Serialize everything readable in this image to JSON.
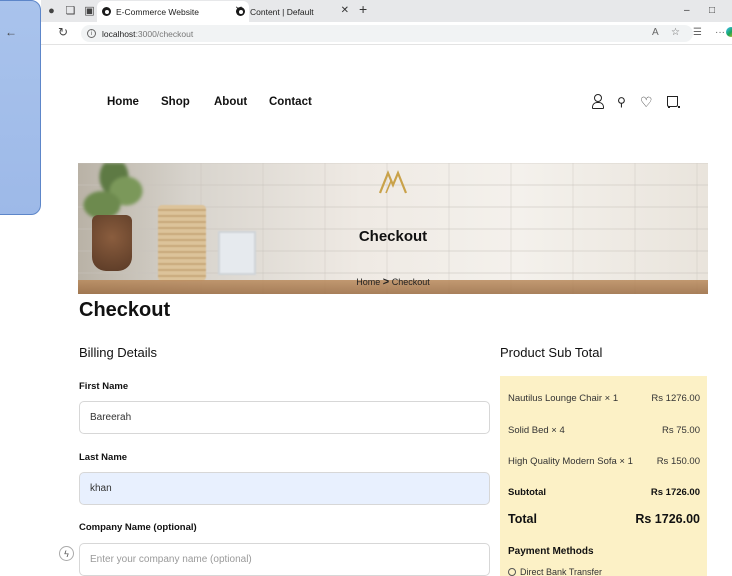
{
  "browser": {
    "tabs": [
      {
        "label": "E-Commerce Website",
        "active": true
      },
      {
        "label": "Content | Default",
        "active": false
      }
    ],
    "new_tab_symbol": "+",
    "url_host": "localhost",
    "url_path": ":3000/checkout",
    "window_min": "–",
    "window_restore": "ꝺ",
    "more_symbol": "···"
  },
  "nav": {
    "links": [
      "Home",
      "Shop",
      "About",
      "Contact"
    ],
    "icons": [
      "user-icon",
      "search-icon",
      "heart-icon",
      "cart-icon"
    ]
  },
  "hero": {
    "title": "Checkout",
    "breadcrumb_home": "Home",
    "breadcrumb_sep": ">",
    "breadcrumb_current": "Checkout"
  },
  "page_title": "Checkout",
  "billing": {
    "title": "Billing Details",
    "first_name_label": "First Name",
    "first_name_value": "Bareerah",
    "last_name_label": "Last Name",
    "last_name_value": "khan",
    "company_label": "Company Name (optional)",
    "company_placeholder": "Enter your company name (optional)"
  },
  "summary": {
    "title": "Product Sub Total",
    "items": [
      {
        "name": "Nautilus Lounge Chair × 1",
        "price": "Rs 1276.00"
      },
      {
        "name": "Solid Bed × 4",
        "price": "Rs 75.00"
      },
      {
        "name": "High Quality Modern Sofa × 1",
        "price": "Rs 150.00"
      }
    ],
    "subtotal_label": "Subtotal",
    "subtotal_value": "Rs 1726.00",
    "total_label": "Total",
    "total_value": "Rs 1726.00",
    "payment_title": "Payment Methods",
    "payment_option": "Direct Bank Transfer"
  },
  "colors": {
    "summary_bg": "#fcf1c6",
    "autofill_bg": "#e8f0fe",
    "side_panel": "#a9c3ec"
  }
}
